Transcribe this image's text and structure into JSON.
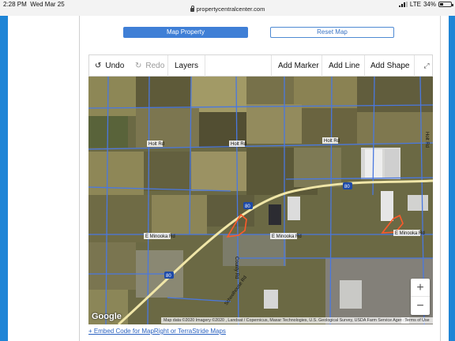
{
  "status_bar": {
    "time": "2:28 PM",
    "date": "Wed Mar 25",
    "url": "propertycentralcenter.com",
    "carrier": "LTE",
    "battery": "34%",
    "battery_level": 0.34
  },
  "actions": {
    "map_property": "Map Property",
    "reset_map": "Reset Map"
  },
  "toolbar": {
    "undo": "Undo",
    "redo": "Redo",
    "layers": "Layers",
    "add_marker": "Add Marker",
    "add_line": "Add Line",
    "add_shape": "Add Shape"
  },
  "map": {
    "roads": {
      "holt_rd_1": "Holt Rd",
      "holt_rd_2": "Holt Rd",
      "holt_rd_3": "Holt Rd",
      "e_minooka_rd_1": "E Minooka Rd",
      "e_minooka_rd_2": "E Minooka Rd",
      "e_minooka_rd_3": "E Minooka Rd",
      "county_rd": "County Rd",
      "schoolhouse_rd": "Schoolhouse Rd",
      "east_rd": "Holt Rd",
      "i80_1": "80",
      "i80_2": "80",
      "i80_3": "80"
    },
    "zoom_in": "+",
    "zoom_out": "−",
    "google": "Google",
    "attribution": "Map data ©2020 Imagery ©2020 , Landsat / Copernicus, Maxar Technologies, U.S. Geological Survey, USDA Farm Service Agency",
    "terms": "Terms of Use",
    "colors": {
      "road": "#4a78e0",
      "parcel": "#ff5a2a",
      "highway": "#f0e6a8"
    }
  },
  "embed_link": "+ Embed Code for MapRight or TerraStride Maps"
}
